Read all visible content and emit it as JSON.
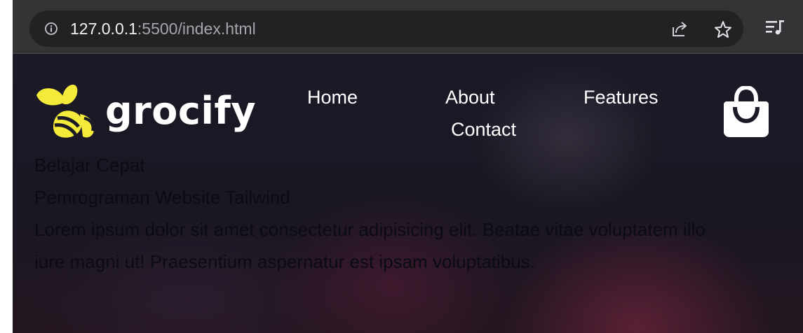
{
  "browser": {
    "url_host": "127.0.0.1",
    "url_rest": ":5500/index.html",
    "icons": {
      "info": "info-icon",
      "share": "share-icon",
      "bookmark": "star-icon",
      "reading_list": "playlist-icon"
    }
  },
  "site": {
    "logo_text": "grocify",
    "nav": [
      {
        "label": "Home"
      },
      {
        "label": "About"
      },
      {
        "label": "Features"
      },
      {
        "label": "Contact"
      }
    ],
    "cart_icon": "shopping-bag-icon"
  },
  "hero": {
    "line1": "Belajar Cepat",
    "line2": "Pemrograman Website Tailwind",
    "description": "Lorem ipsum dolor sit amet consectetur adipisicing elit. Beatae vitae voluptatem illo iure magni ut! Praesentium aspernatur est ipsam voluptatibus."
  },
  "colors": {
    "logo_accent": "#f3ea3a",
    "toolbar": "#343436",
    "omnibox": "#222224"
  }
}
